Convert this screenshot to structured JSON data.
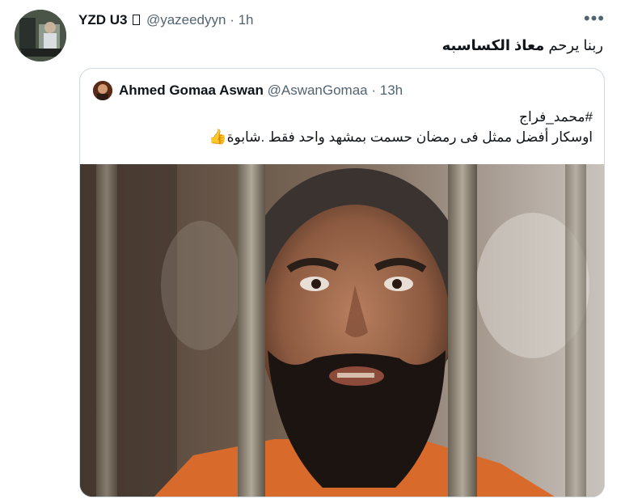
{
  "tweet": {
    "display_name": "YZD U3",
    "handle": "@yazeedyyn",
    "time": "1h",
    "text_plain": "ربنا يرحم ",
    "text_bold": "معاذ الكساسبه",
    "more_label": "•••",
    "avatar_icon": "profile-photo-icon"
  },
  "quoted_tweet": {
    "display_name": "Ahmed Gomaa Aswan",
    "handle": "@AswanGomaa",
    "time": "13h",
    "line1": "#محمد_فراج",
    "line2": "اوسكار أفضل ممثل فى رمضان حسمت بمشهد واحد فقط .شابوة",
    "emoji": "👍",
    "media_icon": "photo-prisoner-behind-bars"
  },
  "separator": " · ",
  "colors": {
    "text": "#0f1419",
    "muted": "#536471",
    "border": "#cfd9de",
    "emoji_yellow": "#f5b72e"
  }
}
